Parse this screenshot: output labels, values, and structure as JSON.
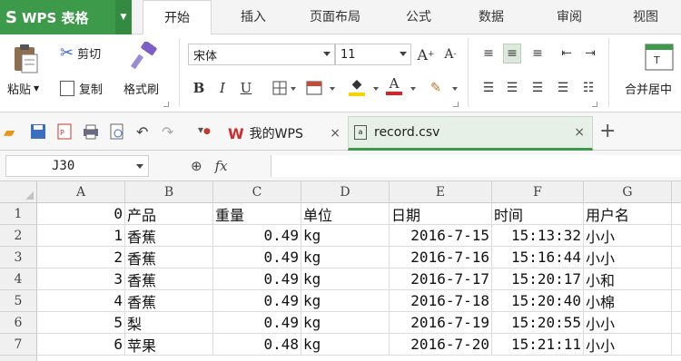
{
  "app": {
    "brand": "WPS 表格",
    "tabs": [
      "开始",
      "插入",
      "页面布局",
      "公式",
      "数据",
      "审阅",
      "视图"
    ],
    "active_tab": "开始"
  },
  "toolbar": {
    "paste": "粘贴",
    "cut": "剪切",
    "copy": "复制",
    "format_painter": "格式刷",
    "font_name": "宋体",
    "font_size": "11",
    "bold": "B",
    "italic": "I",
    "underline": "U",
    "merge_center": "合并居中",
    "font_color": "#e02020",
    "highlight_color": "#f5d400"
  },
  "doc_tabs": [
    {
      "label": "我的WPS",
      "close": "×"
    },
    {
      "label": "record.csv",
      "close": "×"
    }
  ],
  "add_tab": "+",
  "formula_bar": {
    "name_box": "J30",
    "fx": "fx",
    "formula": ""
  },
  "sheet": {
    "columns": [
      "A",
      "B",
      "C",
      "D",
      "E",
      "F",
      "G"
    ],
    "rows": [
      {
        "n": "1",
        "a": "0",
        "b": "产品",
        "c": "重量",
        "d": "单位",
        "e": "日期",
        "f": "时间",
        "g": "用户名"
      },
      {
        "n": "2",
        "a": "1",
        "b": "香蕉",
        "c": "0.49",
        "d": "kg",
        "e": "2016-7-15",
        "f": "15:13:32",
        "g": "小小"
      },
      {
        "n": "3",
        "a": "2",
        "b": "香蕉",
        "c": "0.49",
        "d": "kg",
        "e": "2016-7-16",
        "f": "15:16:44",
        "g": "小小"
      },
      {
        "n": "4",
        "a": "3",
        "b": "香蕉",
        "c": "0.49",
        "d": "kg",
        "e": "2016-7-17",
        "f": "15:20:17",
        "g": "小和"
      },
      {
        "n": "5",
        "a": "4",
        "b": "香蕉",
        "c": "0.49",
        "d": "kg",
        "e": "2016-7-18",
        "f": "15:20:40",
        "g": "小棉"
      },
      {
        "n": "6",
        "a": "5",
        "b": "梨",
        "c": "0.49",
        "d": "kg",
        "e": "2016-7-19",
        "f": "15:20:55",
        "g": "小小"
      },
      {
        "n": "7",
        "a": "6",
        "b": "苹果",
        "c": "0.48",
        "d": "kg",
        "e": "2016-7-20",
        "f": "15:21:11",
        "g": "小小"
      }
    ]
  }
}
